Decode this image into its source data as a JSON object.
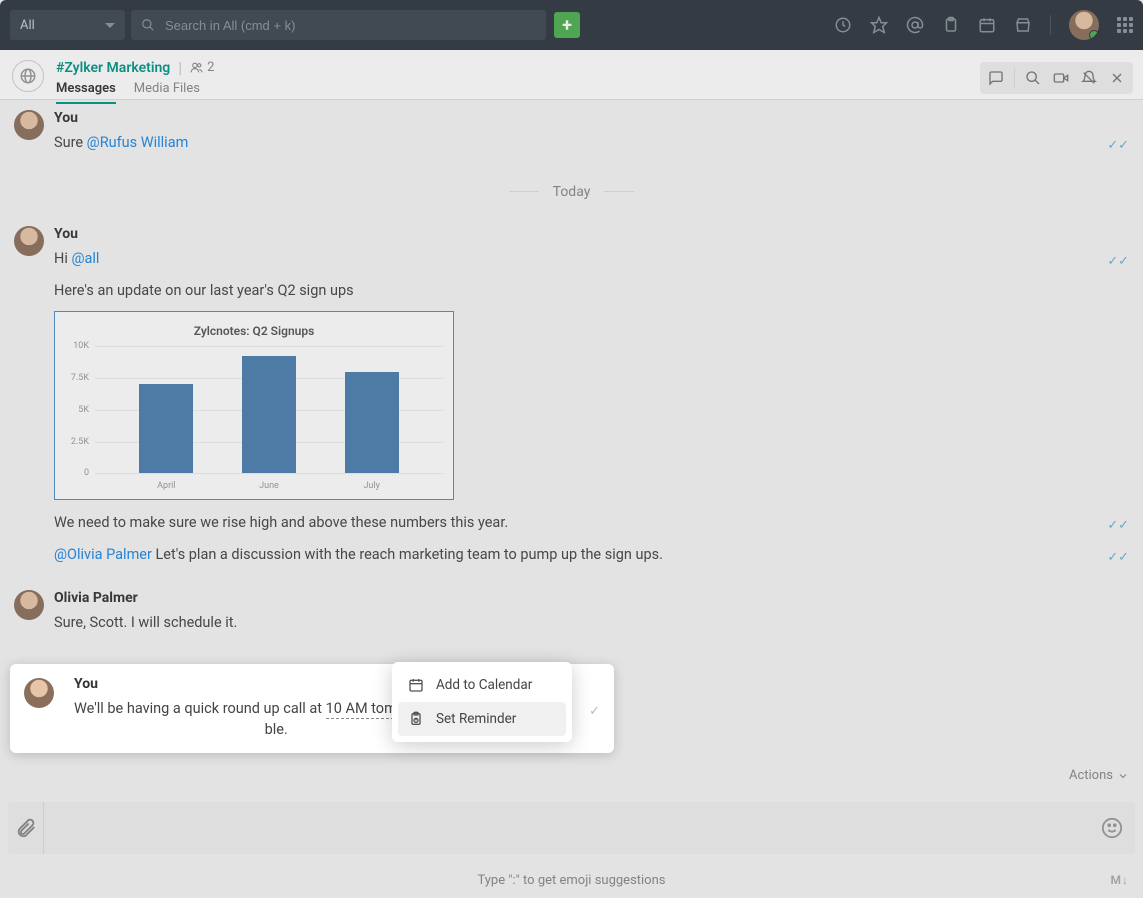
{
  "header": {
    "dropdown_label": "All",
    "search_placeholder": "Search in All (cmd + k)"
  },
  "channel": {
    "name": "#Zylker Marketing",
    "member_count": "2",
    "tabs": {
      "messages": "Messages",
      "media": "Media Files"
    }
  },
  "divider_today": "Today",
  "messages": {
    "m1": {
      "sender": "You",
      "text_pre": "Sure ",
      "mention": "@Rufus William"
    },
    "m2": {
      "sender": "You",
      "line1_pre": "Hi ",
      "line1_mention": "@all",
      "line2": "Here's an update on our last year's Q2 sign ups",
      "line3": "We need to make sure we rise high and above these numbers this year.",
      "line4_mention": "@Olivia Palmer",
      "line4_post": " Let's plan a discussion with the reach marketing team to pump up the sign ups."
    },
    "m3": {
      "sender": "Olivia Palmer",
      "text": "Sure, Scott. I will schedule it."
    },
    "m4": {
      "sender": "You",
      "text_pre": "We'll be having a quick round up call at  ",
      "time": "10 AM tomo.",
      "text_post": "                                                     ble."
    }
  },
  "chart_data": {
    "type": "bar",
    "title": "Zylcnotes: Q2 Signups",
    "categories": [
      "April",
      "June",
      "July"
    ],
    "values": [
      7000,
      9200,
      8000
    ],
    "ylim": [
      0,
      10000
    ],
    "yticks": [
      {
        "label": "10K",
        "value": 10000
      },
      {
        "label": "7.5K",
        "value": 7500
      },
      {
        "label": "5K",
        "value": 5000
      },
      {
        "label": "2.5K",
        "value": 2500
      },
      {
        "label": "0",
        "value": 0
      }
    ]
  },
  "context_menu": {
    "add_calendar": "Add to Calendar",
    "set_reminder": "Set Reminder"
  },
  "actions_label": "Actions",
  "emoji_hint": "Type \":\" to get emoji suggestions",
  "md_label": "M↓"
}
